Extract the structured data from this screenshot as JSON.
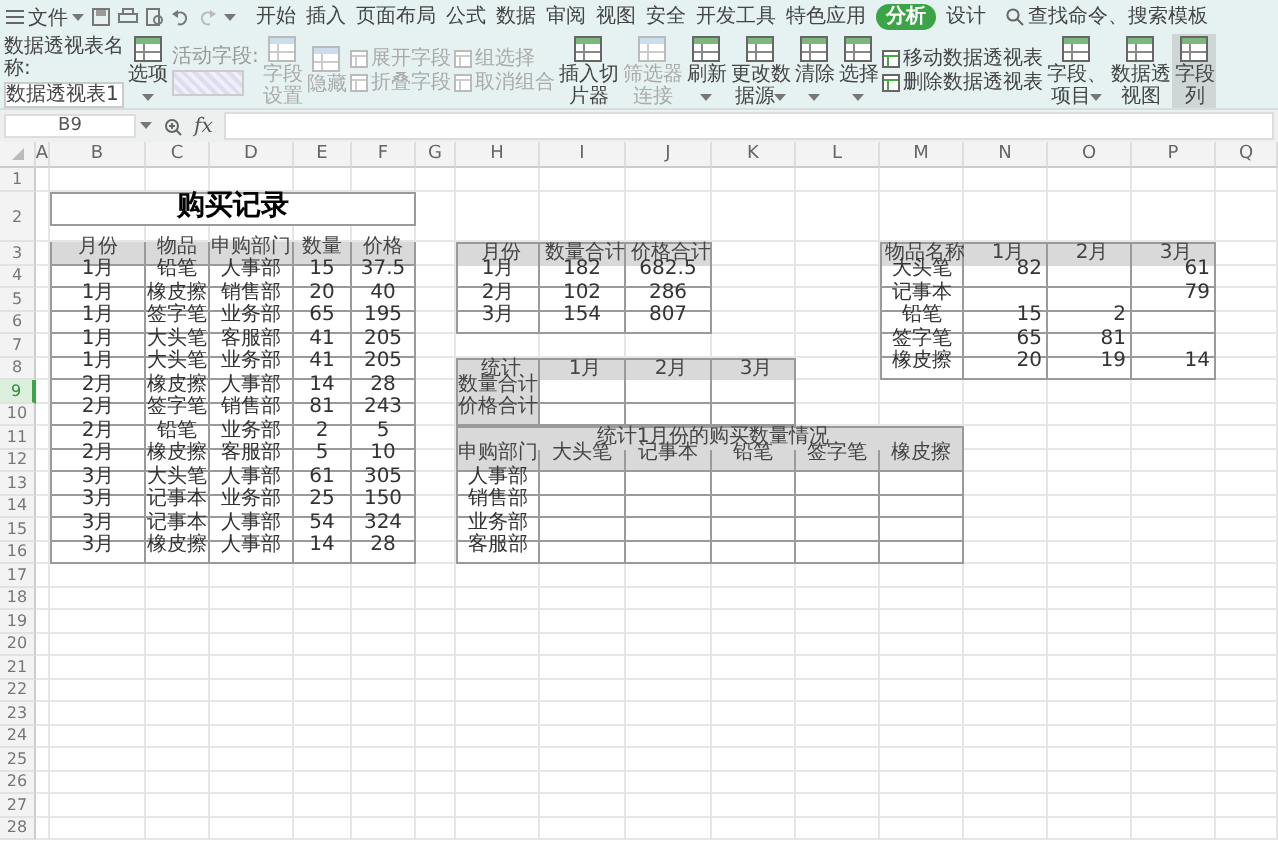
{
  "top_bar": {
    "menu_label": "文件",
    "tabs": [
      {
        "label": "开始",
        "selected": false
      },
      {
        "label": "插入",
        "selected": false
      },
      {
        "label": "页面布局",
        "selected": false
      },
      {
        "label": "公式",
        "selected": false
      },
      {
        "label": "数据",
        "selected": false
      },
      {
        "label": "审阅",
        "selected": false
      },
      {
        "label": "视图",
        "selected": false
      },
      {
        "label": "安全",
        "selected": false
      },
      {
        "label": "开发工具",
        "selected": false
      },
      {
        "label": "特色应用",
        "selected": false
      },
      {
        "label": "分析",
        "selected": true
      },
      {
        "label": "设计",
        "selected": false
      }
    ],
    "search": {
      "placeholder": "查找命令、搜索模板"
    }
  },
  "ribbon": {
    "items": [
      {
        "kind": "name",
        "label": "数据透视表名称:",
        "value": "数据透视表1"
      },
      {
        "kind": "big",
        "label": "选项",
        "dropdown": true,
        "disabled": false,
        "selected": false
      },
      {
        "kind": "field",
        "label": "活动字段:",
        "disabled": true
      },
      {
        "kind": "big",
        "label": "字段设置",
        "dropdown": false,
        "disabled": true,
        "selected": false
      },
      {
        "kind": "big",
        "label": "隐藏",
        "dropdown": false,
        "disabled": true,
        "selected": false
      },
      {
        "kind": "stack",
        "entries": [
          {
            "label": "展开字段",
            "disabled": true
          },
          {
            "label": "折叠字段",
            "disabled": true
          }
        ]
      },
      {
        "kind": "stack",
        "entries": [
          {
            "label": "组选择",
            "disabled": true
          },
          {
            "label": "取消组合",
            "disabled": true
          }
        ]
      },
      {
        "kind": "big",
        "label": "插入切片器",
        "dropdown": false,
        "disabled": false,
        "selected": false
      },
      {
        "kind": "big",
        "label": "筛选器连接",
        "dropdown": false,
        "disabled": true,
        "selected": false
      },
      {
        "kind": "big",
        "label": "刷新",
        "dropdown": true,
        "disabled": false,
        "selected": false
      },
      {
        "kind": "big",
        "label": "更改数据源",
        "dropdown": true,
        "disabled": false,
        "selected": false
      },
      {
        "kind": "big",
        "label": "清除",
        "dropdown": true,
        "disabled": false,
        "selected": false
      },
      {
        "kind": "big",
        "label": "选择",
        "dropdown": true,
        "disabled": false,
        "selected": false
      },
      {
        "kind": "stack",
        "entries": [
          {
            "label": "移动数据透视表",
            "disabled": false
          },
          {
            "label": "删除数据透视表",
            "disabled": false
          }
        ]
      },
      {
        "kind": "big",
        "label": "字段、项目",
        "dropdown": true,
        "disabled": false,
        "selected": false
      },
      {
        "kind": "big",
        "label": "数据透视图",
        "dropdown": false,
        "disabled": false,
        "selected": false
      },
      {
        "kind": "big",
        "label": "字段列",
        "dropdown": false,
        "disabled": false,
        "selected": true
      }
    ]
  },
  "formula_bar": {
    "name_box": "B9",
    "fx": "fx"
  },
  "sheet": {
    "columns": [
      {
        "label": "A",
        "selected": false
      },
      {
        "label": "B",
        "selected": false
      },
      {
        "label": "C",
        "selected": false
      },
      {
        "label": "D",
        "selected": false
      },
      {
        "label": "E",
        "selected": false
      },
      {
        "label": "F",
        "selected": false
      },
      {
        "label": "G",
        "selected": false
      },
      {
        "label": "H",
        "selected": false
      },
      {
        "label": "I",
        "selected": false
      },
      {
        "label": "J",
        "selected": false
      },
      {
        "label": "K",
        "selected": false
      },
      {
        "label": "L",
        "selected": false
      },
      {
        "label": "M",
        "selected": false
      },
      {
        "label": "N",
        "selected": false
      },
      {
        "label": "O",
        "selected": false
      },
      {
        "label": "P",
        "selected": false
      },
      {
        "label": "Q",
        "selected": false
      }
    ],
    "rows": [
      {
        "label": "1",
        "selected": false
      },
      {
        "label": "2",
        "selected": false
      },
      {
        "label": "3",
        "selected": false
      },
      {
        "label": "4",
        "selected": false
      },
      {
        "label": "5",
        "selected": false
      },
      {
        "label": "6",
        "selected": false
      },
      {
        "label": "7",
        "selected": false
      },
      {
        "label": "8",
        "selected": false
      },
      {
        "label": "9",
        "selected": true
      },
      {
        "label": "10",
        "selected": false
      },
      {
        "label": "11",
        "selected": false
      },
      {
        "label": "12",
        "selected": false
      },
      {
        "label": "13",
        "selected": false
      },
      {
        "label": "14",
        "selected": false
      },
      {
        "label": "15",
        "selected": false
      },
      {
        "label": "16",
        "selected": false
      },
      {
        "label": "17",
        "selected": false
      },
      {
        "label": "18",
        "selected": false
      },
      {
        "label": "19",
        "selected": false
      },
      {
        "label": "20",
        "selected": false
      },
      {
        "label": "21",
        "selected": false
      },
      {
        "label": "22",
        "selected": false
      },
      {
        "label": "23",
        "selected": false
      },
      {
        "label": "24",
        "selected": false
      },
      {
        "label": "25",
        "selected": false
      },
      {
        "label": "26",
        "selected": false
      },
      {
        "label": "27",
        "selected": false
      },
      {
        "label": "28",
        "selected": false
      }
    ],
    "tables": [
      {
        "title": "购买记录",
        "columns": [
          "月份",
          "物品",
          "申购部门",
          "数量",
          "价格"
        ],
        "rows": [
          [
            "1月",
            "铅笔",
            "人事部",
            "15",
            "37.5"
          ],
          [
            "1月",
            "橡皮擦",
            "销售部",
            "20",
            "40"
          ],
          [
            "1月",
            "签字笔",
            "业务部",
            "65",
            "195"
          ],
          [
            "1月",
            "大头笔",
            "客服部",
            "41",
            "205"
          ],
          [
            "1月",
            "大头笔",
            "业务部",
            "41",
            "205"
          ],
          [
            "2月",
            "橡皮擦",
            "人事部",
            "14",
            "28"
          ],
          [
            "2月",
            "签字笔",
            "销售部",
            "81",
            "243"
          ],
          [
            "2月",
            "铅笔",
            "业务部",
            "2",
            "5"
          ],
          [
            "2月",
            "橡皮擦",
            "客服部",
            "5",
            "10"
          ],
          [
            "3月",
            "大头笔",
            "人事部",
            "61",
            "305"
          ],
          [
            "3月",
            "记事本",
            "业务部",
            "25",
            "150"
          ],
          [
            "3月",
            "记事本",
            "人事部",
            "54",
            "324"
          ],
          [
            "3月",
            "橡皮擦",
            "人事部",
            "14",
            "28"
          ]
        ]
      },
      {
        "columns": [
          "月份",
          "数量合计",
          "价格合计"
        ],
        "rows": [
          [
            "1月",
            "182",
            "682.5"
          ],
          [
            "2月",
            "102",
            "286"
          ],
          [
            "3月",
            "154",
            "807"
          ]
        ]
      },
      {
        "columns": [
          "统计",
          "1月",
          "2月",
          "3月"
        ],
        "rows": [
          [
            "数量合计",
            null,
            null,
            null
          ],
          [
            "价格合计",
            null,
            null,
            null
          ]
        ]
      },
      {
        "title": "统计1月份的购买数量情况",
        "columns": [
          "申购部门",
          "大头笔",
          "记事本",
          "铅笔",
          "签字笔",
          "橡皮擦"
        ],
        "rows": [
          [
            "人事部",
            null,
            null,
            null,
            null,
            null
          ],
          [
            "销售部",
            null,
            null,
            null,
            null,
            null
          ],
          [
            "业务部",
            null,
            null,
            null,
            null,
            null
          ],
          [
            "客服部",
            null,
            null,
            null,
            null,
            null
          ]
        ]
      },
      {
        "columns": [
          "物品名称",
          "1月",
          "2月",
          "3月"
        ],
        "rows": [
          [
            "大头笔",
            "82",
            null,
            "61"
          ],
          [
            "记事本",
            null,
            null,
            "79"
          ],
          [
            "铅笔",
            "15",
            "2",
            null
          ],
          [
            "签字笔",
            "65",
            "81",
            null
          ],
          [
            "橡皮擦",
            "20",
            "19",
            "14"
          ]
        ]
      }
    ]
  }
}
